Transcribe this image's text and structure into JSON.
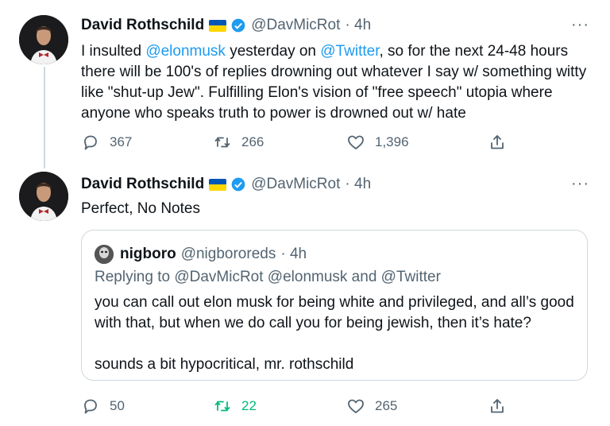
{
  "colors": {
    "link": "#1d9bf0",
    "muted": "#536471",
    "retweet_active": "#00ba7c",
    "border": "#cfd9de"
  },
  "icons": [
    "reply-icon",
    "retweet-icon",
    "like-icon",
    "share-icon",
    "verified-icon",
    "ukraine-flag-icon",
    "more-icon"
  ],
  "tweet1": {
    "name": "David Rothschild",
    "handle": "@DavMicRot",
    "time": "· 4h",
    "more": "···",
    "text_parts": [
      "I insulted ",
      "@elonmusk",
      " yesterday on ",
      "@Twitter",
      ", so for the next 24-48 hours there will be 100's of replies drowning out whatever I say w/ something witty like \"shut-up Jew\". Fulfilling Elon's vision of \"free speech\" utopia where anyone who speaks truth to power is drowned out w/ hate"
    ],
    "replies": "367",
    "retweets": "266",
    "likes": "1,396"
  },
  "tweet2": {
    "name": "David Rothschild",
    "handle": "@DavMicRot",
    "time": "· 4h",
    "more": "···",
    "text": "Perfect, No Notes",
    "quote": {
      "name": "nigboro",
      "handle": "@nigbororeds",
      "time": "· 4h",
      "replying": "Replying to @DavMicRot @elonmusk and @Twitter",
      "text1": "you can call out elon musk for being white and privileged, and all’s good with that, but when we do call you for being jewish, then it’s hate?",
      "text2": "sounds a bit hypocritical, mr. rothschild"
    },
    "replies": "50",
    "retweets": "22",
    "likes": "265"
  }
}
